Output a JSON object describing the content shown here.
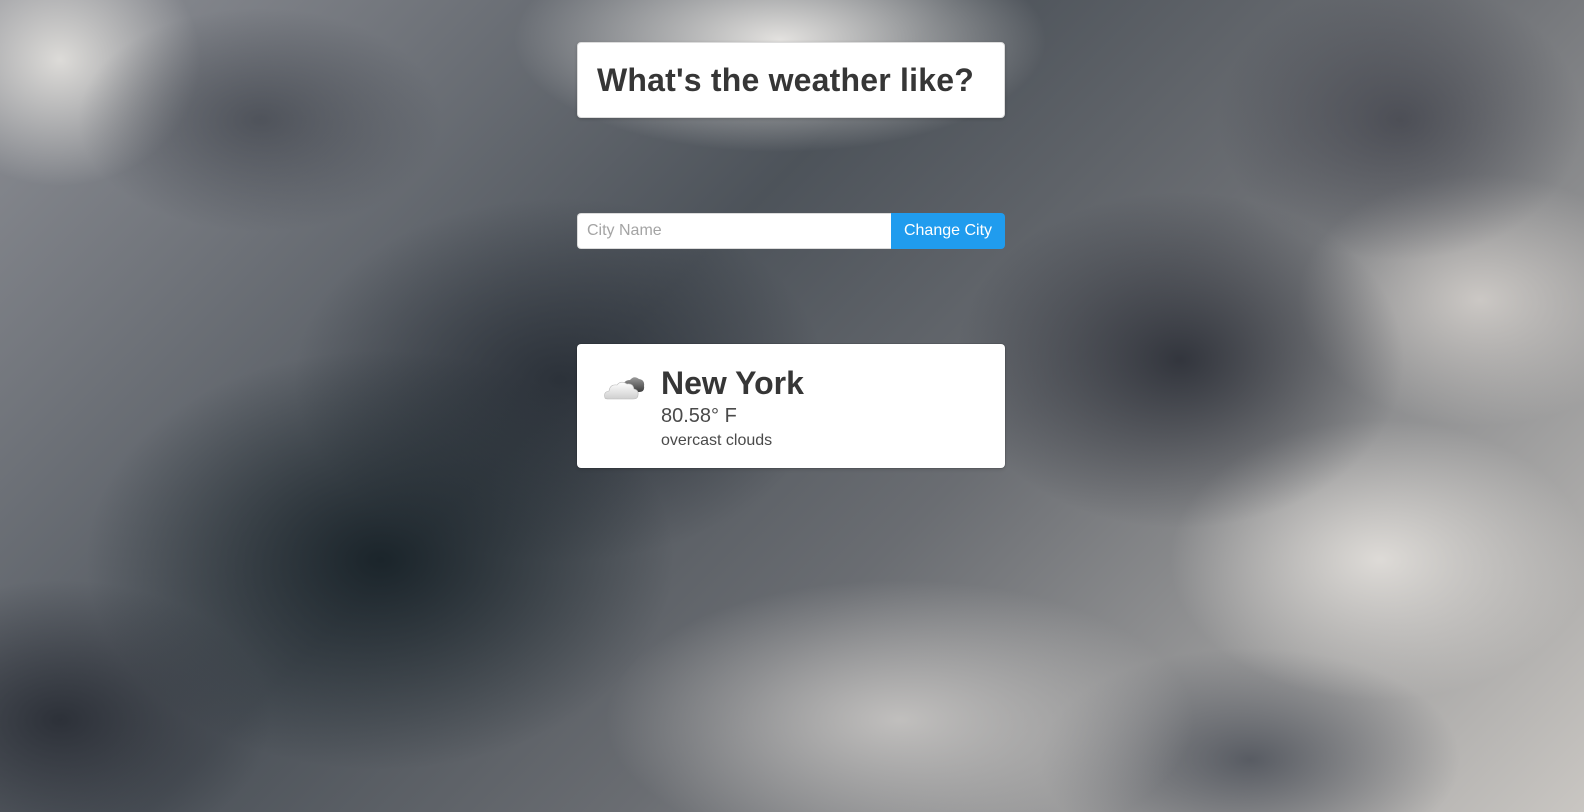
{
  "header": {
    "title": "What's the weather like?"
  },
  "search": {
    "placeholder": "City Name",
    "value": "",
    "button_label": "Change City",
    "button_color": "#209cee"
  },
  "weather": {
    "icon": "cloud-icon",
    "city": "New York",
    "temperature": "80.58° F",
    "description": "overcast clouds"
  }
}
